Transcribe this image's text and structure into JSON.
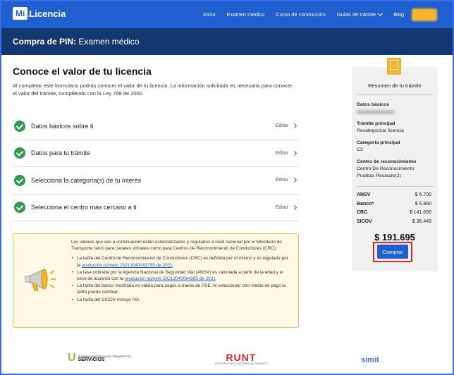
{
  "header": {
    "logo_mi": "Mi",
    "logo_licencia": "Licencia",
    "logo_sub": "BY RUNT",
    "nav": [
      "Inicio",
      "Examen medico",
      "Curso de conducción",
      "Guías de trámite",
      "Blog"
    ]
  },
  "titlebar": {
    "bold": "Compra de PIN:",
    "rest": " Examen médico"
  },
  "main": {
    "heading": "Conoce el valor de tu licencia",
    "intro": "Al completar este formulario podrás conocer el valor de tu licencia. La información solicitada es necesaria para conocer el valor del trámite, cumpliendo con la Ley 769 de 2002.",
    "edit_label": "Editar",
    "steps": [
      "Datos básicos sobre ti",
      "Datos para tu trámite",
      "Selecciona la categoría(s) de tu interés",
      "Selecciona el centro más cercano a ti"
    ]
  },
  "notice": {
    "para": "Los valores que ves a continuación están estandarizados y regulados a nivel nacional por el Ministerio de Transporte tanto para canales virtuales como para Centros de Reconocimiento de Conductores (CRC)",
    "b1_text": "La tarifa del Centro de Reconocimiento de Conductores (CRC) es definida por el mismo y es regulada por la ",
    "b1_link": "resolución número 20213040063755 de 2021",
    "b2_text": "La tasa cobrada por la Agencia Nacional de Seguridad Vial (ANSV) es calculada a partir de la edad y el sexo de acuerdo con la ",
    "b2_link": "resolución número 20213040064285 de 2021",
    "b3": "La tarifa del banco mostrada es válida para pagos a través de PSE. Al seleccionar otro medio de pago la tarifa puede cambiar.",
    "b4": "La tarifa del SICOV incluye IVA"
  },
  "summary": {
    "title": "Resumen de tu trámite",
    "datos_basicos_label": "Datos básicos",
    "tramite_label": "Trámite principal",
    "tramite_value": "Recategorizar licencia",
    "categoria_label": "Categoría principal",
    "categoria_value": "C3",
    "centro_label": "Centro de reconocimiento",
    "centro_value": "Centro De Reconocimiento Pruebas Recaudo(2)",
    "fees": [
      {
        "k": "ANSV",
        "v": "$ 6.700"
      },
      {
        "k": "Banco*",
        "v": "$ 6.890"
      },
      {
        "k": "CRC",
        "v": "$ 141.656"
      },
      {
        "k": "SICOV",
        "v": "$ 36.449"
      }
    ],
    "total": "$ 191.695",
    "buy_label": "Comprar"
  },
  "footer": {
    "l1_small": "SUPERINTENDENCIA DE TRANSPORTE",
    "l1_big": "SERVICIOS",
    "l2": "RUNT",
    "l2_sub": "REGISTRO ÚNICO NACIONAL DE TRÁNSITO",
    "l3": "simit"
  },
  "colors": {
    "brand_blue": "#1f5fd0",
    "dark_navy": "#15376f",
    "success": "#2e9b4e",
    "warning_bg": "#fff8e5",
    "accent_yellow": "#f5b52a",
    "highlight_red": "#e0262b"
  }
}
